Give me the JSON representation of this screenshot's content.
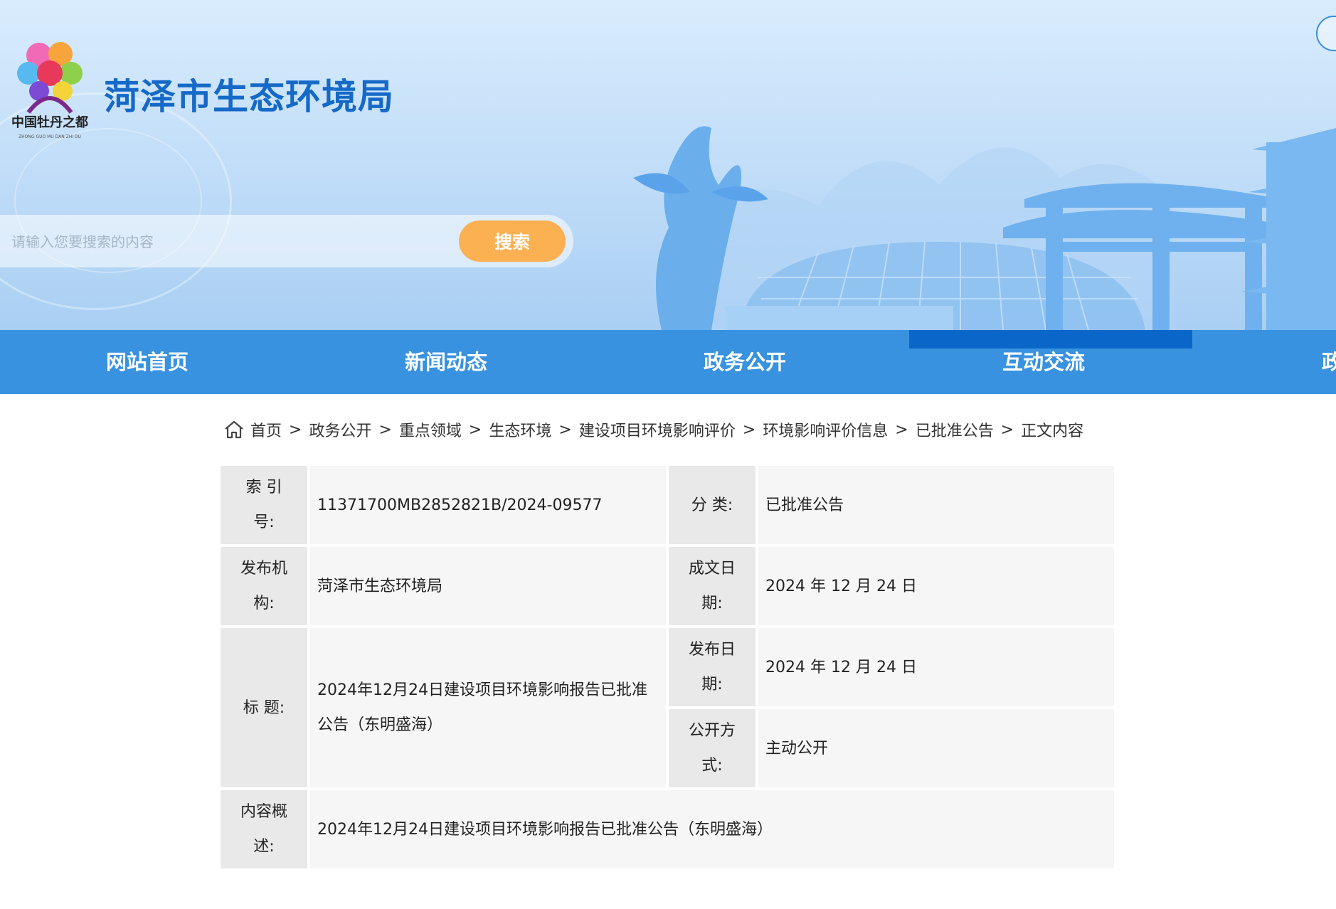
{
  "header": {
    "site_title": "菏泽市生态环境局",
    "logo_text": "中国牡丹之都",
    "search": {
      "placeholder": "请输入您要搜索的内容",
      "button_label": "搜索"
    }
  },
  "nav": {
    "items": [
      {
        "label": "网站首页"
      },
      {
        "label": "新闻动态"
      },
      {
        "label": "政务公开"
      },
      {
        "label": "互动交流"
      },
      {
        "label": "政务"
      }
    ]
  },
  "breadcrumb": {
    "items": [
      "首页",
      "政务公开",
      "重点领域",
      "生态环境",
      "建设项目环境影响评价",
      "环境影响评价信息",
      "已批准公告",
      "正文内容"
    ],
    "separator": ">"
  },
  "info": {
    "index_label": "索 引 号:",
    "index_value": "11371700MB2852821B/2024-09577",
    "category_label": "分 类:",
    "category_value": "已批准公告",
    "publisher_label": "发布机构:",
    "publisher_value": "菏泽市生态环境局",
    "written_date_label": "成文日期:",
    "written_date_value": "2024 年 12 月 24 日",
    "title_label": "标 题:",
    "title_value": "2024年12月24日建设项目环境影响报告已批准公告（东明盛海）",
    "publish_date_label": "发布日期:",
    "publish_date_value": "2024 年 12 月 24 日",
    "disclosure_label": "公开方式:",
    "disclosure_value": "主动公开",
    "summary_label": "内容概述:",
    "summary_value": "2024年12月24日建设项目环境影响报告已批准公告（东明盛海）"
  },
  "colors": {
    "title_blue": "#1569c7",
    "nav_blue": "#3892e0",
    "search_orange": "#fbb152"
  }
}
